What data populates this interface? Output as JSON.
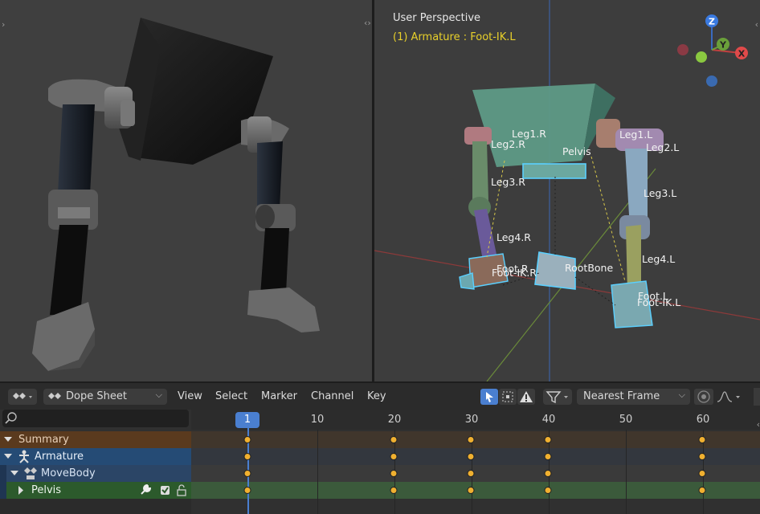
{
  "viewport_left": {},
  "viewport_right": {
    "view_name": "User Perspective",
    "active_object": "(1) Armature : Foot-IK.L",
    "gizmo_labels": {
      "z": "Z",
      "y": "Y",
      "x": "X"
    },
    "bones": [
      "Leg1.R",
      "Leg2.R",
      "Pelvis",
      "Leg1.L",
      "Leg2.L",
      "Leg3.R",
      "Leg3.L",
      "Leg4.R",
      "Leg4.L",
      "Foot.R",
      "Foot-IK.R",
      "RootBone",
      "Foot.L",
      "Foot-IK.L"
    ]
  },
  "dopesheet": {
    "editor_type": "Dope Sheet",
    "menus": [
      "View",
      "Select",
      "Marker",
      "Channel",
      "Key"
    ],
    "snapping": "Nearest Frame",
    "current_frame": "1",
    "ruler_ticks": [
      "10",
      "20",
      "30",
      "40",
      "50",
      "60"
    ],
    "channels": [
      {
        "name": "Summary"
      },
      {
        "name": "Armature"
      },
      {
        "name": "MoveBody"
      },
      {
        "name": "Pelvis"
      }
    ],
    "keyframes": [
      "1",
      "20",
      "30",
      "40",
      "60"
    ],
    "colors": {
      "summary": "#5a3a1e",
      "armature": "#254b75",
      "action": "#2b4566",
      "group": "#2c5a2c",
      "keyframe": "#f0b030",
      "playhead": "#4a7fd0"
    }
  }
}
